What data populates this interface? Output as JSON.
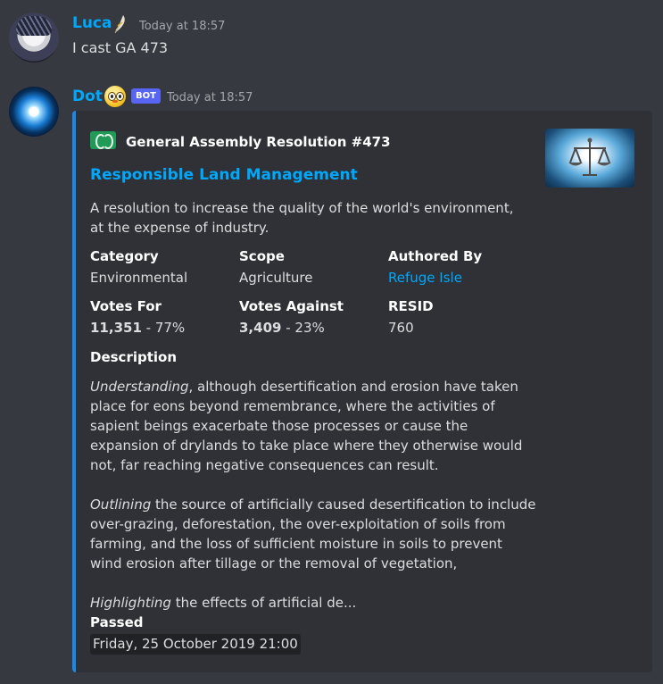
{
  "messages": [
    {
      "username": "Luca",
      "username_color": "#00a8fc",
      "badge_icon": "feather-icon",
      "timestamp": "Today at 18:57",
      "content": "I cast GA 473"
    },
    {
      "username": "Dot",
      "username_color": "#00a8fc",
      "emoji_icon": "chick-emoji-icon",
      "bot_tag": "BOT",
      "timestamp": "Today at 18:57"
    }
  ],
  "embed": {
    "accent_color": "#1a88ea",
    "author_icon": "nationstates-wa-icon",
    "author": "General Assembly Resolution #473",
    "title": "Responsible Land Management",
    "description": "A resolution to increase the quality of the world's environment, at the expense of industry.",
    "thumbnail_icon": "scales-of-justice-icon",
    "fields": [
      {
        "name": "Category",
        "value": "Environmental"
      },
      {
        "name": "Scope",
        "value": "Agriculture"
      },
      {
        "name": "Authored By",
        "value": "Refuge Isle"
      },
      {
        "name": "Votes For",
        "value_bold": "11,351",
        "value_rest": " - 77%"
      },
      {
        "name": "Votes Against",
        "value_bold": "3,409",
        "value_rest": " - 23%"
      },
      {
        "name": "RESID",
        "value": "760"
      }
    ],
    "long_description": {
      "name": "Description",
      "paragraphs": [
        {
          "italic": "Understanding",
          "text": ", although desertification and erosion have taken place for eons beyond remembrance, where the activities of sapient beings exacerbate those processes or cause the expansion of drylands to take place where they otherwise would not, far reaching negative consequences can result."
        },
        {
          "italic": "Outlining",
          "text": " the source of artificially caused desertification to include over-grazing, deforestation, the over-exploitation of soils from farming, and the loss of sufficient moisture in soils to prevent wind erosion after tillage or the removal of vegetation,"
        },
        {
          "italic": "Highlighting",
          "text": " the effects of artificial de..."
        }
      ]
    },
    "passed": {
      "name": "Passed",
      "value": "Friday, 25 October 2019 21:00"
    }
  }
}
